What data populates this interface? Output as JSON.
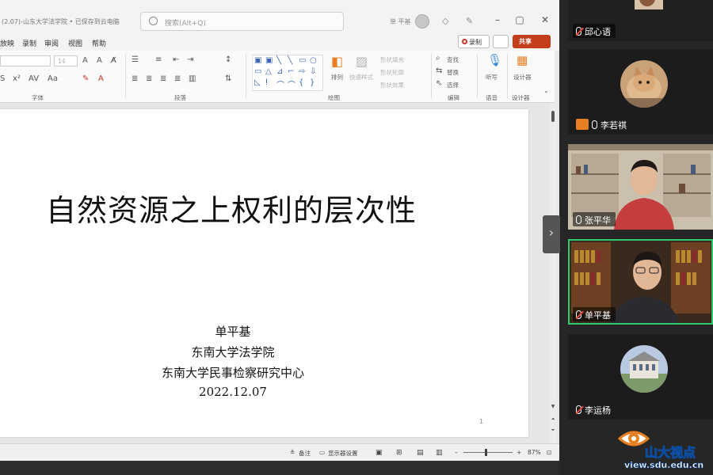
{
  "window": {
    "doc_title": "(2.07)-山东大学法学院 • 已保存到云电脑",
    "search_placeholder": "搜索(Alt+Q)",
    "user_name": "单 平基"
  },
  "menu": {
    "items": [
      "放映",
      "录制",
      "审阅",
      "视图",
      "帮助"
    ],
    "record_label": "录制",
    "share_label": "共享"
  },
  "ribbon": {
    "font_size": "14",
    "groups": {
      "font": "字体",
      "paragraph": "段落",
      "drawing": "绘图",
      "editing": "编辑",
      "voice": "语音",
      "designer": "设计器"
    },
    "arrange_label": "排列",
    "quick_styles_label": "快速样式",
    "shape_fill_label": "形状填充",
    "shape_outline_label": "形状轮廓",
    "shape_effects_label": "形状效果",
    "find_label": "查找",
    "replace_label": "替换",
    "select_label": "选择",
    "dictate_label": "听写",
    "designer_label": "设计器"
  },
  "slide": {
    "title": "自然资源之上权利的层次性",
    "author": "单平基",
    "affiliation_1": "东南大学法学院",
    "affiliation_2": "东南大学民事检察研究中心",
    "date": "2022.12.07",
    "number": "1"
  },
  "statusbar": {
    "notes_label": "备注",
    "display_settings_label": "显示器设置",
    "zoom": "87%"
  },
  "participants": [
    {
      "name": "邱心语",
      "muted": true
    },
    {
      "name": "李若祺",
      "muted": false
    },
    {
      "name": "张平华",
      "muted": false
    },
    {
      "name": "单平基",
      "muted": true,
      "speaking": true
    },
    {
      "name": "李运杨",
      "muted": true
    }
  ],
  "watermark": {
    "brand": "山大视点",
    "url": "view.sdu.edu.cn"
  }
}
